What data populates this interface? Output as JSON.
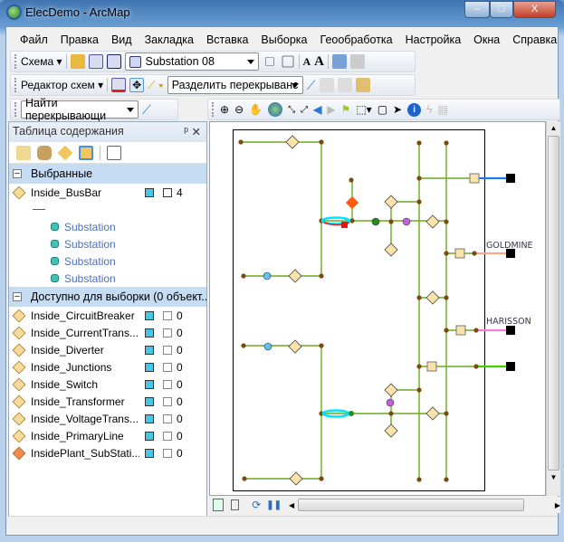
{
  "window": {
    "title": "ElecDemo - ArcMap",
    "minimize": "–",
    "maximize": "□",
    "close": "X"
  },
  "menu": [
    "Файл",
    "Правка",
    "Вид",
    "Закладка",
    "Вставка",
    "Выборка",
    "Геообработка",
    "Настройка",
    "Окна",
    "Справка"
  ],
  "toolbar_schema": {
    "label": "Схема",
    "diagram_select": "Substation 08"
  },
  "toolbar_editor": {
    "label": "Редактор схем",
    "rule_select": "Разделить перекрыванс"
  },
  "toolbar_find": {
    "select": "Найти перекрывающи"
  },
  "toc": {
    "title": "Таблица содержания",
    "groups": [
      {
        "label": "Выбранные",
        "layers": [
          {
            "name": "Inside_BusBar",
            "count": "4"
          }
        ],
        "sublabels": [
          "Substation",
          "Substation",
          "Substation",
          "Substation"
        ]
      },
      {
        "label": "Доступно для выборки (0 объект...",
        "layers": [
          {
            "name": "Inside_CircuitBreaker",
            "count": "0"
          },
          {
            "name": "Inside_CurrentTrans...",
            "count": "0"
          },
          {
            "name": "Inside_Diverter",
            "count": "0"
          },
          {
            "name": "Inside_Junctions",
            "count": "0"
          },
          {
            "name": "Inside_Switch",
            "count": "0"
          },
          {
            "name": "Inside_Transformer",
            "count": "0"
          },
          {
            "name": "Inside_VoltageTrans...",
            "count": "0"
          },
          {
            "name": "Inside_PrimaryLine",
            "count": "0"
          },
          {
            "name": "InsidePlant_SubStati...",
            "count": "0"
          }
        ]
      }
    ]
  },
  "map": {
    "labels": {
      "goldmine": "GOLDMINE",
      "harisson": "HARISSON"
    },
    "colors": {
      "line": "#6aaa1e",
      "node": "#7a4a10",
      "diamond": "#fbe2a8",
      "selected": "#00e5ff",
      "blue_feeder": "#1e78f0",
      "salmon_feeder": "#f4a890",
      "pink_feeder": "#f080d0",
      "green_feeder": "#40d000"
    }
  }
}
